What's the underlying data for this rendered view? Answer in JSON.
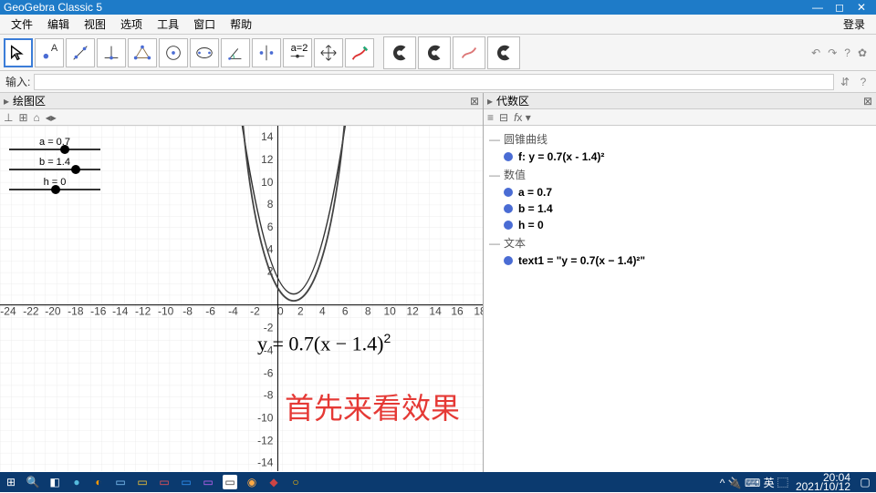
{
  "window": {
    "title": "GeoGebra Classic 5"
  },
  "menu": {
    "file": "文件",
    "edit": "编辑",
    "view": "视图",
    "options": "选项",
    "tools": "工具",
    "window": "窗口",
    "help": "帮助",
    "login": "登录"
  },
  "inputbar": {
    "label": "输入:",
    "value": ""
  },
  "panels": {
    "graph": "绘图区",
    "algebra": "代数区"
  },
  "graph_toolbar": {
    "axes": "⊞",
    "grid": "#",
    "home": "⌂",
    "nav": "⇄"
  },
  "sliders": {
    "a": {
      "label": "a = 0.7",
      "pos": 0.6
    },
    "b": {
      "label": "b = 1.4",
      "pos": 0.72
    },
    "h": {
      "label": "h = 0",
      "pos": 0.5
    }
  },
  "formula_html": "y = 0.7(x − 1.4)<sup>2</sup>",
  "red_caption": "首先来看效果",
  "algebra_tree": {
    "cat_conic": "圆锥曲线",
    "f": "f: y = 0.7(x - 1.4)²",
    "cat_number": "数值",
    "a": "a = 0.7",
    "b": "b = 1.4",
    "h": "h = 0",
    "cat_text": "文本",
    "text1": "text1  =  \"y = 0.7(x − 1.4)²\""
  },
  "algebra_toolbar": {
    "fx": "fx",
    "arrow": "▾"
  },
  "chart_data": {
    "type": "line",
    "title": "",
    "xlabel": "",
    "ylabel": "",
    "xlim": [
      -24,
      18
    ],
    "ylim": [
      -14,
      15
    ],
    "series": [
      {
        "name": "f",
        "expression": "y = 0.7*(x-1.4)^2",
        "x": [
          -3,
          -2,
          -1,
          0,
          1,
          1.4,
          2,
          3,
          4,
          5,
          6
        ],
        "values": [
          13.55,
          8.09,
          4.03,
          1.37,
          0.11,
          0,
          0.25,
          1.79,
          4.73,
          9.07,
          14.81
        ]
      }
    ],
    "sliders": [
      {
        "name": "a",
        "value": 0.7
      },
      {
        "name": "b",
        "value": 1.4
      },
      {
        "name": "h",
        "value": 0
      }
    ]
  },
  "taskbar": {
    "time": "20:04",
    "date": "2021/10/12",
    "ime": "^ 🔌 ⌨ 英 ⬚"
  }
}
